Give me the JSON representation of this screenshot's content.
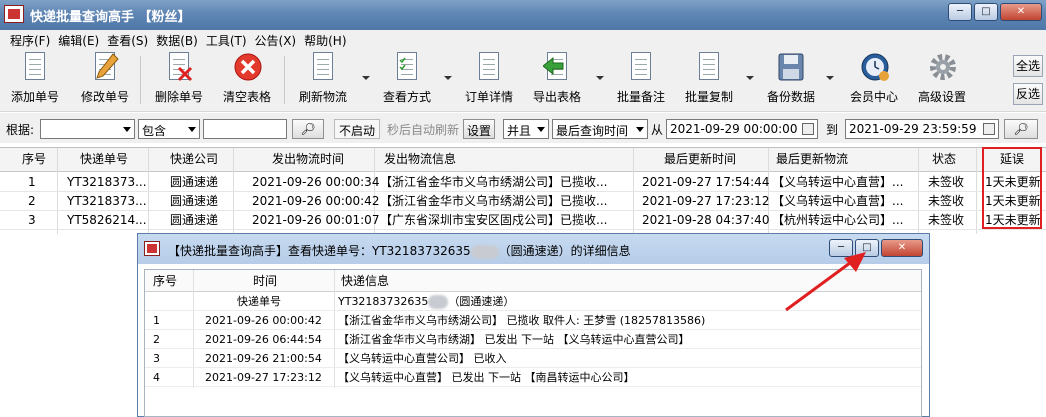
{
  "window": {
    "title": "快递批量查询高手 【粉丝】",
    "min_label": "─",
    "max_label": "□",
    "close_label": "✕"
  },
  "menu": [
    "程序(F)",
    "编辑(E)",
    "查看(S)",
    "数据(B)",
    "工具(T)",
    "公告(X)",
    "帮助(H)"
  ],
  "toolbar": {
    "add": "添加单号",
    "edit": "修改单号",
    "delete": "删除单号",
    "clear": "清空表格",
    "refresh": "刷新物流",
    "view_mode": "查看方式",
    "order_detail": "订单详情",
    "export": "导出表格",
    "batch_note": "批量备注",
    "batch_copy": "批量复制",
    "backup": "备份数据",
    "member": "会员中心",
    "advanced": "高级设置",
    "select_all": "全选",
    "invert": "反选"
  },
  "filter": {
    "basis_label": "根据:",
    "basis_value": "",
    "match_value": "包含",
    "keyword_value": "",
    "auto_refresh_status": "不启动",
    "auto_refresh_label": "秒后自动刷新",
    "settings_button": "设置",
    "logic_value": "并且",
    "time_field_value": "最后查询时间",
    "from_label": "从",
    "from_value": "2021-09-29 00:00:00",
    "to_label": "到",
    "to_value": "2021-09-29 23:59:59"
  },
  "grid": {
    "columns": [
      "序号",
      "快递单号",
      "快递公司",
      "发出物流时间",
      "发出物流信息",
      "最后更新时间",
      "最后更新物流",
      "状态",
      "延误"
    ],
    "rows": [
      [
        "1",
        "YT3218373...",
        "圆通速递",
        "2021-09-26 00:00:34",
        "【浙江省金华市义乌市绣湖公司】已揽收...",
        "2021-09-27 17:54:44",
        "【义乌转运中心直营】...",
        "未签收",
        "1天未更新"
      ],
      [
        "2",
        "YT3218373...",
        "圆通速递",
        "2021-09-26 00:00:42",
        "【浙江省金华市义乌市绣湖公司】已揽收...",
        "2021-09-27 17:23:12",
        "【义乌转运中心直营】...",
        "未签收",
        "1天未更新"
      ],
      [
        "3",
        "YT5826214...",
        "圆通速递",
        "2021-09-26 00:01:07",
        "【广东省深圳市宝安区固戍公司】已揽收...",
        "2021-09-28 04:37:40",
        "【杭州转运中心公司】...",
        "未签收",
        "1天未更新"
      ]
    ]
  },
  "dialog": {
    "title_prefix": "【快递批量查询高手】查看快递单号：YT32183732635",
    "title_suffix": "（圆通速递）的详细信息",
    "columns": [
      "序号",
      "时间",
      "快递信息"
    ],
    "tracking_label": "快递单号",
    "tracking_value": "YT32183732635",
    "tracking_company": "（圆通速递）",
    "rows": [
      [
        "1",
        "2021-09-26 00:00:42",
        "【浙江省金华市义乌市绣湖公司】 已揽收 取件人: 王梦雪 (18257813586)"
      ],
      [
        "2",
        "2021-09-26 06:44:54",
        "【浙江省金华市义乌市绣湖】 已发出 下一站 【义乌转运中心直营公司】"
      ],
      [
        "3",
        "2021-09-26 21:00:54",
        "【义乌转运中心直营公司】 已收入"
      ],
      [
        "4",
        "2021-09-27 17:23:12",
        "【义乌转运中心直营】 已发出 下一站 【南昌转运中心公司】"
      ]
    ]
  },
  "colors": {
    "highlight_red": "#e02020",
    "titlebar_blue": "#5f86b4"
  }
}
